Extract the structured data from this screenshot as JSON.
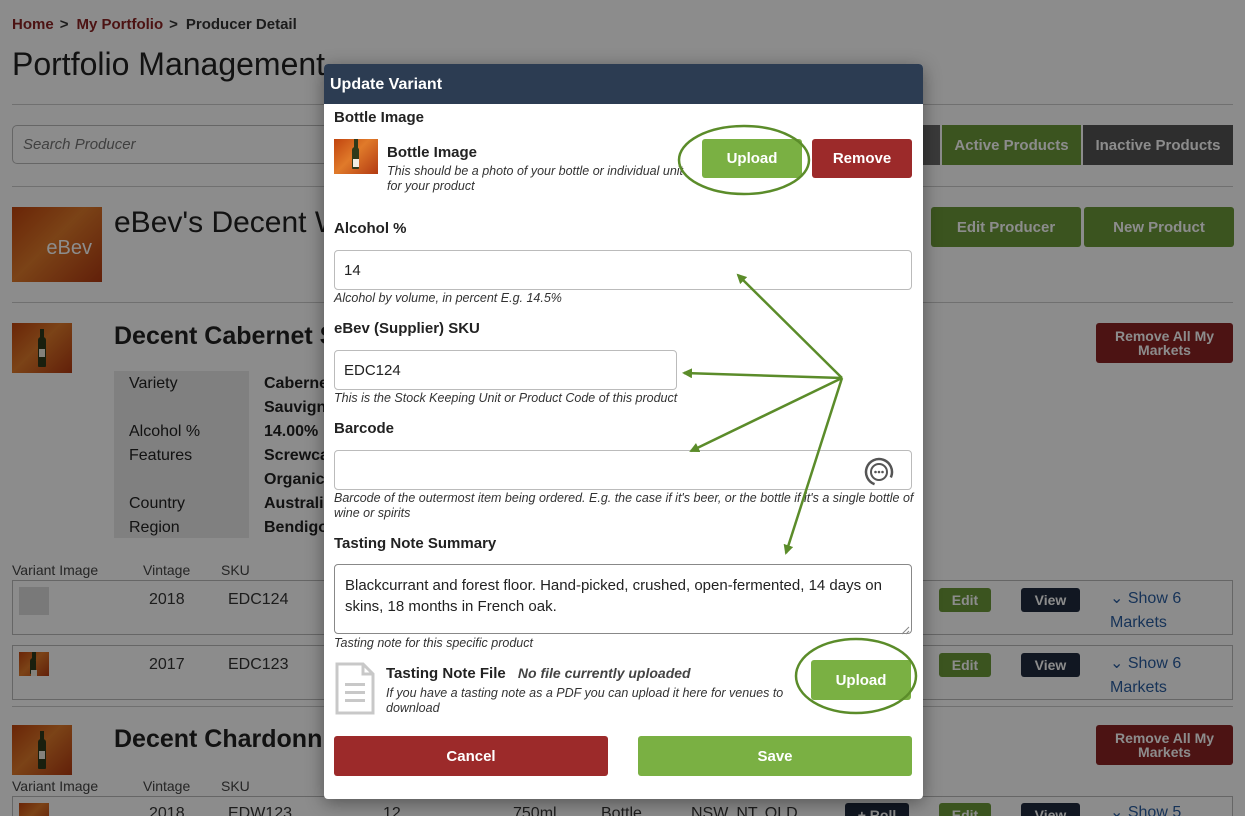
{
  "breadcrumb": {
    "home": "Home",
    "portfolio": "My Portfolio",
    "sep": ">",
    "current": "Producer Detail"
  },
  "page_title": "Portfolio Management",
  "search": {
    "placeholder": "Search Producer"
  },
  "filters": {
    "active": "Active Products",
    "inactive": "Inactive Products"
  },
  "producer": {
    "name": "eBev's Decent W",
    "logo_text": "eBev",
    "edit_label": "Edit Producer",
    "new_product_label": "New Product"
  },
  "product1": {
    "name": "Decent Cabernet S",
    "remove_markets": "Remove All My Markets",
    "specs": {
      "variety_key": "Variety",
      "variety_val1": "Caberne",
      "variety_val2": "Sauvigno",
      "alcohol_key": "Alcohol %",
      "alcohol_val": "14.00%",
      "features_key": "Features",
      "features_val1": "Screwca",
      "features_val2": "Organic",
      "country_key": "Country",
      "country_val": "Australia",
      "region_key": "Region",
      "region_val": "Bendigo"
    }
  },
  "variants_header": {
    "image": "Variant Image",
    "vintage": "Vintage",
    "sku": "SKU"
  },
  "variants": [
    {
      "vintage": "2018",
      "sku": "EDC124",
      "edit": "Edit",
      "view": "View",
      "show": "Show 6",
      "markets": "Markets"
    },
    {
      "vintage": "2017",
      "sku": "EDC123",
      "edit": "Edit",
      "view": "View",
      "show": "Show 6",
      "markets": "Markets"
    }
  ],
  "product2": {
    "name": "Decent Chardonn",
    "remove_markets": "Remove All My Markets",
    "row": {
      "vintage": "2018",
      "sku": "EDW123",
      "qty": "12",
      "size": "750ml",
      "unit": "Bottle",
      "states": "NSW, NT, QLD",
      "roll": "+ Roll",
      "edit": "Edit",
      "view": "View",
      "show": "Show 5"
    }
  },
  "modal": {
    "title": "Update Variant",
    "bottle_section_label": "Bottle Image",
    "bottle_image_title": "Bottle Image",
    "bottle_image_help": "This should be a photo of your bottle or individual unit for your product",
    "upload_label": "Upload",
    "remove_label": "Remove",
    "alcohol_label": "Alcohol %",
    "alcohol_value": "14",
    "alcohol_help": "Alcohol by volume, in percent E.g. 14.5%",
    "sku_label": "eBev (Supplier) SKU",
    "sku_value": "EDC124",
    "sku_help": "This is the Stock Keeping Unit or Product Code of this product",
    "barcode_label": "Barcode",
    "barcode_value": "",
    "barcode_help": "Barcode of the outermost item being ordered. E.g. the case if it's beer, or the bottle if it's a single bottle of wine or spirits",
    "tasting_label": "Tasting Note Summary",
    "tasting_value": "Blackcurrant and forest floor. Hand-picked, crushed, open-fermented, 14 days on skins, 18 months in French oak.",
    "tasting_help": "Tasting note for this specific product",
    "tasting_file_title": "Tasting Note File",
    "tasting_file_status": "No file currently uploaded",
    "tasting_file_help": "If you have a tasting note as a PDF you can upload it here for venues to download",
    "file_upload_label": "Upload",
    "cancel_label": "Cancel",
    "save_label": "Save"
  },
  "colors": {
    "accent_green": "#7ab043",
    "danger_red": "#9c2a2a",
    "header_navy": "#2c3c52",
    "annotation_green": "#5b8c2a"
  }
}
